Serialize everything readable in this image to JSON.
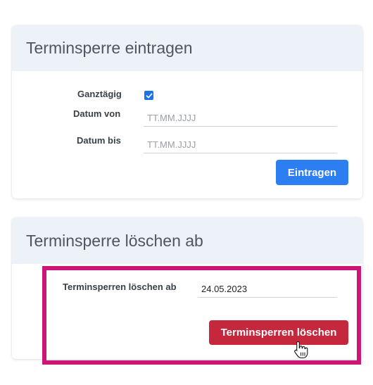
{
  "block_form": {
    "title": "Terminsperre eintragen",
    "all_day_label": "Ganztägig",
    "all_day_checked": true,
    "date_from_label": "Datum von",
    "date_from_placeholder": "TT.MM.JJJJ",
    "date_to_label": "Datum bis",
    "date_to_placeholder": "TT.MM.JJJJ",
    "submit_label": "Eintragen"
  },
  "delete_form": {
    "title": "Terminsperre löschen ab",
    "date_label": "Terminsperren löschen ab",
    "date_value": "24.05.2023",
    "submit_label": "Terminsperren löschen"
  },
  "colors": {
    "header_bg": "#edf2f9",
    "primary": "#2d7ef0",
    "danger": "#c5283d",
    "highlight": "#cc1577"
  },
  "icons": {
    "checkbox": "check-icon",
    "cursor": "hand-pointer-icon"
  }
}
